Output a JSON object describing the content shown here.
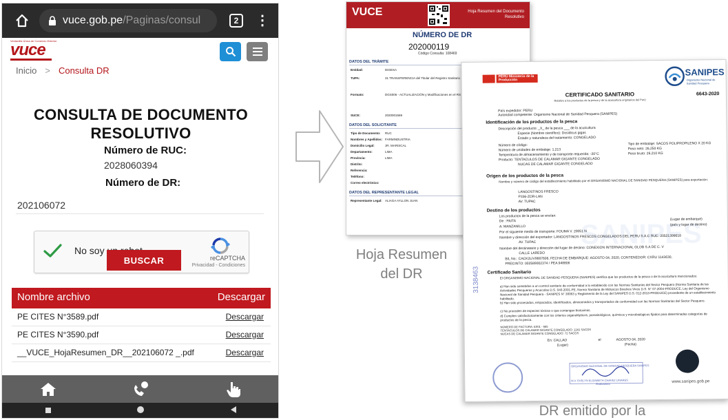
{
  "browser": {
    "url_host": "vuce.gob.pe",
    "url_path": "/Paginas/consul",
    "tab_count": "2"
  },
  "site": {
    "logo_tagline": "Ventanilla Única de Comercio Exterior",
    "logo_text": "vuce",
    "logo_country": "Perú"
  },
  "breadcrumb": {
    "home": "Inicio",
    "separator": ">",
    "current": "Consulta DR"
  },
  "page": {
    "title_line1": "CONSULTA DE DOCUMENTO",
    "title_line2": "RESOLUTIVO"
  },
  "form": {
    "ruc_label": "Número de RUC:",
    "ruc_value": "2028060394",
    "dr_label": "Número de DR:",
    "dr_value": "202106072",
    "captcha_label": "No soy un robot",
    "captcha_brand": "reCAPTCHA",
    "captcha_links": "Privacidad - Condiciones",
    "search_button": "BUSCAR"
  },
  "files": {
    "col_name": "Nombre archivo",
    "col_download": "Descargar",
    "rows": [
      {
        "name": "PE CITES N°3589.pdf",
        "link": "Descargar"
      },
      {
        "name": "PE CITES N°3590.pdf",
        "link": "Descargar"
      },
      {
        "name": "__VUCE_HojaResumen_DR__202106072 _.pdf",
        "link": "Descargar"
      }
    ]
  },
  "hoja_resumen": {
    "brand": "VUCE",
    "header_title": "Hoja Resumen del Documento Resolutivo",
    "numero_label": "NÚMERO DE DR",
    "numero_value": "202000119",
    "consulta": "Código Consulta: 108469",
    "sec_tramite": "DATOS DEL TRÁMITE",
    "entidad_label": "Entidad:",
    "entidad_value": "DIGESA",
    "tupa_label": "TUPA:",
    "tupa_value": "31 TRANSFERENCIA del Titular del Registro Sanitario",
    "formato_label": "Formato:",
    "formato_value": "DGS006 - ACTUALIZACIÓN y Modificaciones en el RS",
    "suce_label": "SUCE:",
    "suce_value": "2020001569",
    "sec_solicitante": "DATOS DEL SOLICITANTE",
    "tipo_doc_label": "Tipo de Documento:",
    "tipo_doc_value": "RUC",
    "nombres_label": "Nombres y Apellidos:",
    "nombres_value": "FARMINDUSTRIA",
    "domicilio_label": "Domicilio Legal:",
    "domicilio_value": "JR. MARISCAL",
    "departamento_label": "Departamento:",
    "departamento_value": "LIMA",
    "provincia_label": "Provincia:",
    "provincia_value": "LIMA",
    "distrito_label": "Distrito:",
    "referencia_label": "Referencia:",
    "telefono_label": "Teléfono:",
    "correo_label": "Correo electrónico:",
    "sec_representante": "DATOS DEL REPRESENTANTE LEGAL",
    "representante_label": "Representante Legal:",
    "representante_value": "ALIAGA AYLLON JUAN",
    "caption_line1": "Hoja Resumen",
    "caption_line2": "del DR"
  },
  "certificado": {
    "peru_label": "PERÚ Ministerio de la Producción",
    "sanipes_name": "SANIPES",
    "sanipes_sub": "Organismo Nacional de Sanidad Pesquera",
    "title": "CERTIFICADO SANITARIO",
    "subtitle": "Relativo a los productos de la pesca y de la acuicultura originarios del Perú",
    "number": "6643-2020",
    "pais_expedidor": "País expedidor: PERU",
    "autoridad": "Autoridad competente: Organismo Nacional de Sanidad Pesquera (SANIPES)",
    "sec1": "Identificación de los productos de la pesca",
    "desc_producto": "Descripción del producto: _X_ de la pesca ___ de la acuicultura",
    "especie": "Especie (Nombre científico): Dosidicus gigas",
    "estado": "Estado y naturaleza del tratamiento: CONGELADO",
    "num_codigo": "Número de código:",
    "num_unidades": "Número de unidades de embalaje: 1,213",
    "temperatura": "Temperatura de almacenamiento y de transporte requerida: -20°C",
    "producto": "Producto: TENTACULOS DE CALAMAR GIGANTE CONGELADO",
    "producto2": "NUCAS DE CALAMAR GIGANTE CONGELADO",
    "tipo_embalaje": "Tipo de embalaje: SACOS POLIPROPILENO X 20 KG",
    "peso_neto": "Peso neto: 26,250 KG",
    "peso_bruto": "Peso bruto: 26,210 KG",
    "sec2": "Origen de los productos de la pesca",
    "origen_text": "Nombre y número de código del establecimiento habilitado por el ORGANISMO NACIONAL DE SANIDAD PESQUERA (SANIPES) para exportación:",
    "origen_est": "LANGOSTINOS FRESCO",
    "origen_code": "P336-ZOR-LAN",
    "origen_av": "AV. TUPAC",
    "sec3": "Destino de los productos",
    "destino_env": "Los productos de la pesca se envían:",
    "destino_de": "De : PAITA",
    "destino_a": "A: MANZANILLO",
    "destino_lugar": "(Lugar de embarque)",
    "destino_pais": "(país y lugar de destino)",
    "transporte": "Por el siguiente medio de transporte: FOUMA V. 20051 N",
    "exportador": "Nombre y dirección del exportador: LANGOSTINOS FRESCOS CONGELADOS DEL PERU S.A.C RUC: 20521399618",
    "exportador_av": "AV. TUPAC",
    "destinatario": "Nombre del destinatario y dirección del lugar de destino: CONEXION INTERNACIONAL GLOB S.A DE C. V",
    "destinatario2": "CALLE LAREDO",
    "bl": "B/L No.: CACK2LIV9887606, FECHA DE EMBARQUE: AGOSTO 04, 2020, CONTENEDOR: CXRU 1143630,",
    "precinto": "PRECINTO: 002589002374 / PEA 948806",
    "sec4": "Certificado Sanitario",
    "cert_intro": "El ORGANISMO NACIONAL DE SANIDAD PESQUERA (SANIPES) certifica que los productos de la pesca o de la acuicultura mencionados:",
    "cert_a": "a) Han sido sometidos a un control sanitario de conformidad a lo establecido con las Normas Sanitarias del Sector Pesquero (Norma Sanitaria de las Actividades Pesqueras y Acuícolas D.S. 040-2001-PE, Norma Sanitaria de Moluscos Bivalvos Vivos D.S. N° 07-2004-PRODUCE, Ley del Organismo Nacional de Sanidad Pesquera - SANIPES N° 30063 y Reglamento de la Ley del SANIPES D.S. 012-2013-PRODUCE) procedente de un establecimiento habilitado.",
    "cert_b": "b) Han sido procesados, empacados, identificados, almacenados y transportados de conformidad con las Normas Sanitarias del Sector Pesquero.",
    "cert_c": "c) No proceden de especies tóxicas o que contengan biotoxinas.",
    "cert_d": "d) Cumplen satisfactoriamente con los criterios organolépticos, parasitológicos, químicos y microbiológicos fijados para determinadas categorías de productos de la pesca.",
    "factura": "NÚMERO DE FACTURA: E001 - 665",
    "tentaculos": "TENTACULOS DE CALAMAR GIGANTE CONGELADO: 1241 SACOS",
    "nucas": "NUCAS DE CALAMAR GIGANTE CONGELADO: 72 SACOS",
    "en": "En: CALLAO",
    "el": "el",
    "fecha": "AGOSTO 04, 2020",
    "lugar": "(Lugar)",
    "fecha_label": "(Fecha)",
    "stamp_side": "3138463",
    "seal_org": "ORGANISMO NACIONAL DE SANIDAD PESQUERA SANIPES",
    "seal_name": "M.V. EVELYN ELIZABETH CHAVEZ LINARES",
    "seal_role": "Evaluadora",
    "web": "www.sanipes.gob.pe",
    "caption": "DR emitido por la"
  },
  "colors": {
    "brand_red": "#c0191f",
    "search_blue": "#1f8fd6",
    "dark_nav": "#606060"
  }
}
